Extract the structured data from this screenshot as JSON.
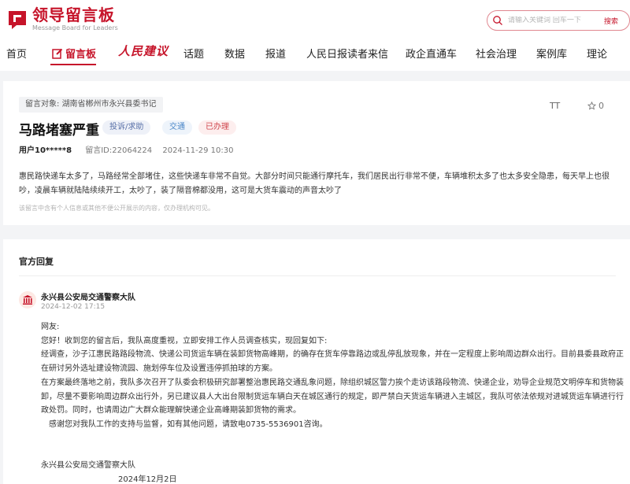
{
  "header": {
    "logo_title": "领导留言板",
    "logo_subtitle": "Message Board for Leaders",
    "search_placeholder": "请输入关键词 回车一下",
    "search_button": "搜索",
    "accent_color": "#c6142a"
  },
  "nav": {
    "items": [
      "首页",
      "留言板",
      "人民建议",
      "话题",
      "数据",
      "报道",
      "人民日报读者来信",
      "政企直通车",
      "社会治理",
      "案例库",
      "理论"
    ],
    "active": "留言板"
  },
  "message": {
    "target_label": "留言对象:",
    "target": "湖南省郴州市永兴县委书记",
    "font_button": "TT",
    "like_count": "0",
    "title": "马路堵塞严重",
    "tags": {
      "type": "投诉/求助",
      "field": "交通",
      "status": "已办理"
    },
    "user": "用户10*****8",
    "id_label": "留言ID:",
    "id": "22064224",
    "datetime": "2024-11-29 10:30",
    "content": "惠民路快递车太多了，马路经常全部堵住，这些快递车非常不自觉。大部分时间只能通行摩托车，我们居民出行非常不便，车辆堆积太多了也太多安全隐患，每天早上也很吵，凌晨车辆就陆陆续续开工，太吵了，装了隔音棉都没用，这可是大货车震动的声音太吵了",
    "notice": "该留言中含有个人信息或其他不便公开展示的内容，仅办理机构可见。"
  },
  "reply": {
    "heading": "官方回复",
    "org": "永兴县公安局交通警察大队",
    "datetime": "2024-12-02 17:15",
    "paragraphs": [
      "网友:",
      "您好！收到您的留言后，我队高度重视，立即安排工作人员调查核实，现回复如下:",
      "经调查，沙子江惠民路路段物流、快递公司货运车辆在装卸货物高峰期，的确存在货车停靠路边或乱停乱放现象，并在一定程度上影响周边群众出行。目前县委县政府正在研讨另外选址建设物流园、施划停车位及设置违停抓拍球的方案。",
      "在方案最终落地之前，我队多次召开了队委会积极研究部署整治惠民路交通乱象问题，除组织城区警力挨个走访该路段物流、快递企业，劝导企业规范文明停车和货物装卸，尽量不要影响周边群众出行外，另已建议县人大出台限制货运车辆白天在城区通行的规定，即严禁白天货运车辆进入主城区，我队可依法依规对进城货运车辆进行行政处罚。同时，也请周边广大群众能理解快递企业高峰期装卸货物的需求。",
      "感谢您对我队工作的支持与监督，如有其他问题，请致电0735-5536901咨询。"
    ],
    "signature_org": "永兴县公安局交通警察大队",
    "signature_date": "2024年12月2日"
  }
}
